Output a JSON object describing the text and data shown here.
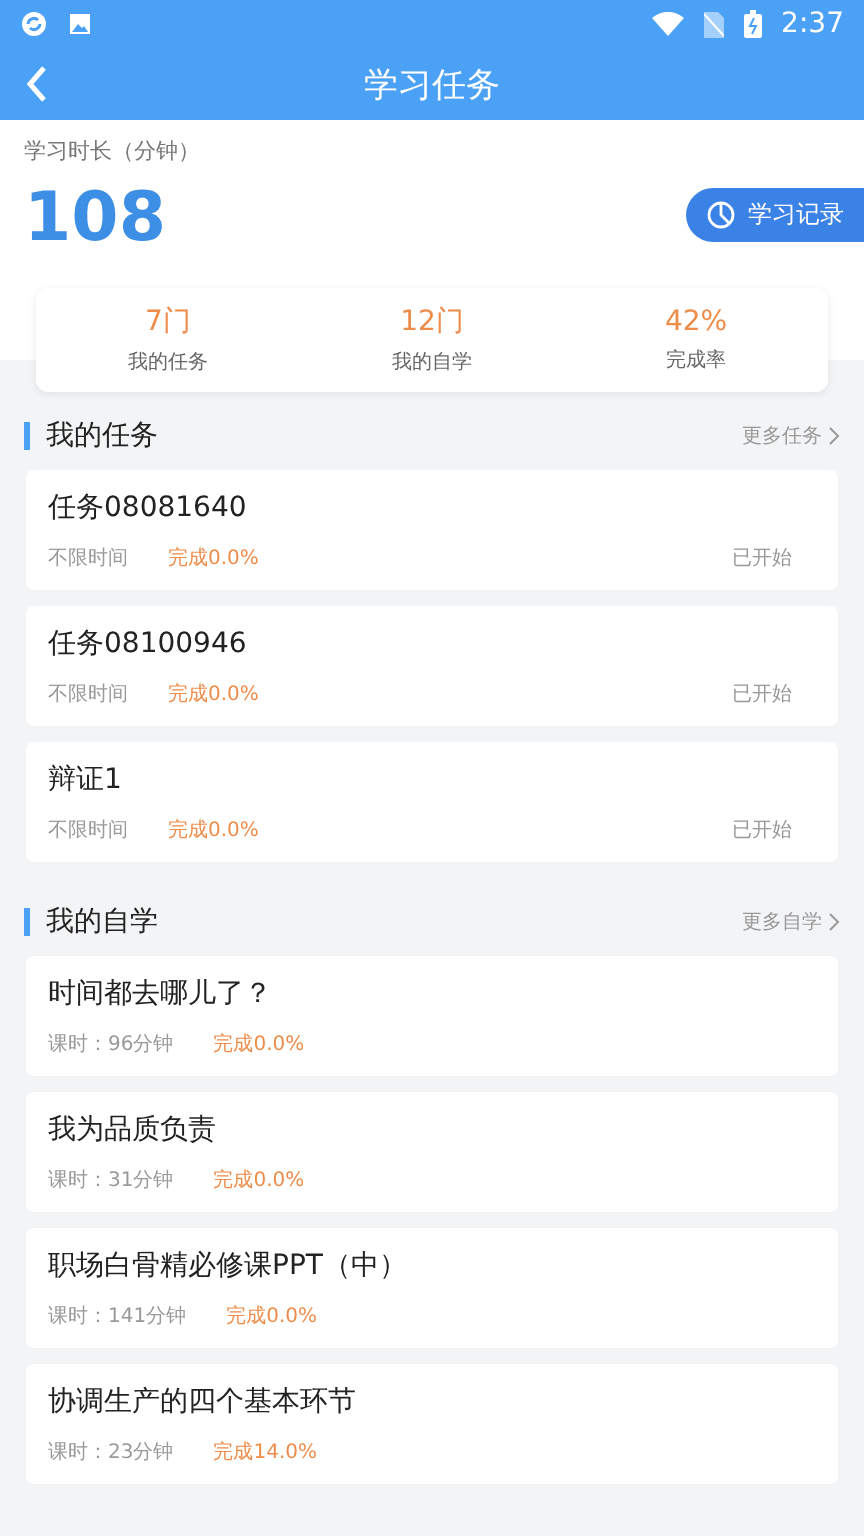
{
  "status_bar": {
    "time": "2:37"
  },
  "app_bar": {
    "title": "学习任务"
  },
  "summary": {
    "label": "学习时长（分钟）",
    "value": "108",
    "record_button": "学习记录"
  },
  "stats": [
    {
      "value": "7门",
      "label": "我的任务"
    },
    {
      "value": "12门",
      "label": "我的自学"
    },
    {
      "value": "42%",
      "label": "完成率"
    }
  ],
  "sections": [
    {
      "title": "我的任务",
      "more": "更多任务",
      "items": [
        {
          "title": "任务08081640",
          "meta": "不限时间",
          "progress": "完成0.0%",
          "status": "已开始"
        },
        {
          "title": "任务08100946",
          "meta": "不限时间",
          "progress": "完成0.0%",
          "status": "已开始"
        },
        {
          "title": "辩证1",
          "meta": "不限时间",
          "progress": "完成0.0%",
          "status": "已开始"
        }
      ]
    },
    {
      "title": "我的自学",
      "more": "更多自学",
      "items": [
        {
          "title": "时间都去哪儿了？",
          "meta": "课时：96分钟",
          "progress": "完成0.0%"
        },
        {
          "title": "我为品质负责",
          "meta": "课时：31分钟",
          "progress": "完成0.0%"
        },
        {
          "title": "职场白骨精必修课PPT（中）",
          "meta": "课时：141分钟",
          "progress": "完成0.0%"
        },
        {
          "title": "协调生产的四个基本环节",
          "meta": "课时：23分钟",
          "progress": "完成14.0%"
        }
      ]
    }
  ]
}
